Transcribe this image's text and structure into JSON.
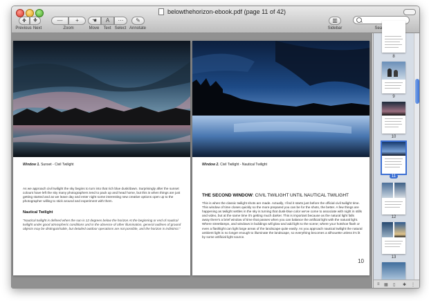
{
  "window": {
    "title": "belowthehorizon-ebook.pdf (page 11 of 42)"
  },
  "toolbar": {
    "previous_label": "Previous",
    "next_label": "Next",
    "zoom_label": "Zoom",
    "move_label": "Move",
    "text_label": "Text",
    "select_label": "Select",
    "annotate_label": "Annotate",
    "sidebar_label": "Sidebar",
    "search_label": "Search",
    "search_placeholder": ""
  },
  "left_page": {
    "caption_label": "Window 1.",
    "caption_text": " Sunset - Civil Twilight",
    "paragraph": "As we approach civil twilight the sky begins to turn into that rich blue dusk/dawn. Surprisingly after the sunset colours have left the sky many photographers tend to pack up and head home, but this is when things are just getting started and as we leave day and enter night some interesting new creative options open up to the photographer willing to stick around and experiment with them.",
    "subheading": "Nautical Twilight",
    "quote": "\"Nautical twilight is defined when the sun is 12 degrees below the horizon At the beginning or end of nautical twilight under good atmospheric conditions and in the absence of other illumination, general outlines of ground objects may be distinguishable, but detailed outdoor operations are not possible, and the horizon is indistinct.\""
  },
  "right_page": {
    "caption_label": "Window 2.",
    "caption_text": " Civil Twilight - Nautical Twilight",
    "heading_bold": "THE SECOND WINDOW",
    "heading_rest": ": CIVIL TWILIGHT UNTIL NAUTICAL TWILIGHT",
    "paragraph": "This is when the classic twilight shots are made. Actually, I find it starts just before the official civil twilight time. This window of time closes quickly so the more prepared you can be for the shots, the better. A few things are happening as twilight settles in the sky is turning that dusk-blue color we've come to associate with night in stills and video, but at the same time it's getting much darker. This is important because as the natural light falls away there's a brief window of time that passes when you can balance the artificial light with the natural light. Where streetlamps, and windows in buildings will glow and add light to the scene; where your hotshoe flash or even a flashlight can light large areas of the landscape quite easily. As you approach nautical twilight the natural ambient light is no longer enough to illuminate the landscape, so everything becomes a silhouette unless it's lit by some artificial light source.",
    "page_number": "10"
  },
  "sidebar": {
    "thumbnails": [
      {
        "label": "8"
      },
      {
        "label": "9"
      },
      {
        "label": "10"
      },
      {
        "label": "11"
      },
      {
        "label": "12"
      },
      {
        "label": "13"
      }
    ]
  },
  "colors": {
    "selection": "#3b6fd3",
    "content_background": "#919191"
  }
}
